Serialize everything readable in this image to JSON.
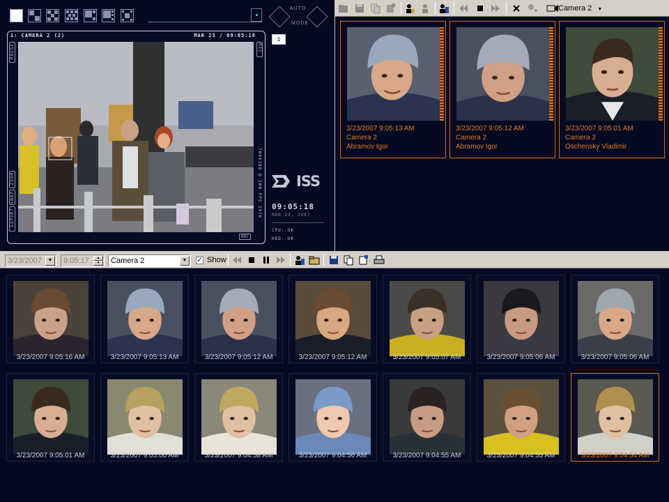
{
  "video": {
    "camera_title": "1: CAMERA 2 (2)",
    "timestamp": "MAR 23 / 09:05:18",
    "resolution_info": "704X288 @ 200 FPS 297K",
    "side_labels": [
      "PAUSE",
      "ZOOM",
      "SNAP",
      "EXPORT"
    ],
    "side_label_right_top": "REC",
    "rec_label": "REC",
    "camera_number": "1",
    "mode_labels": [
      "AUTO",
      "MODE"
    ]
  },
  "branding": {
    "logo": "ISS"
  },
  "clock": {
    "time": "09:05:18",
    "date": "MAR 23, 2007"
  },
  "status": {
    "cpu": "CPU: OK",
    "hdd": "HDD: OK"
  },
  "identification": {
    "camera_select": "Camera 2",
    "matches": [
      {
        "datetime": "3/23/2007 9:05:13 AM",
        "camera": "Camera 2",
        "name": "Abramov Igor"
      },
      {
        "datetime": "3/23/2007 9:05:12 AM",
        "camera": "Camera 2",
        "name": "Abramov Igor"
      },
      {
        "datetime": "3/23/2007 9:05:01 AM",
        "camera": "Camera 2",
        "name": "Oschensky Vladimir"
      }
    ]
  },
  "gallery_toolbar": {
    "date": "3/23/2007",
    "time": "9:05:17",
    "camera": "Camera 2",
    "show_label": "Show",
    "show_checked": "✓"
  },
  "gallery": [
    {
      "time": "3/23/2007 9:05:16 AM"
    },
    {
      "time": "3/23/2007 9:05:13 AM"
    },
    {
      "time": "3/23/2007 9:05:12 AM"
    },
    {
      "time": "3/23/2007 9:05:12 AM"
    },
    {
      "time": "3/23/2007 9:05:07 AM"
    },
    {
      "time": "3/23/2007 9:05:06 AM"
    },
    {
      "time": "3/23/2007 9:05:06 AM"
    },
    {
      "time": "3/23/2007 9:05:01 AM"
    },
    {
      "time": "3/23/2007 9:05:00 AM"
    },
    {
      "time": "3/23/2007 9:04:58 AM"
    },
    {
      "time": "3/23/2007 9:04:56 AM"
    },
    {
      "time": "3/23/2007 9:04:55 AM"
    },
    {
      "time": "3/23/2007 9:04:55 AM"
    },
    {
      "time": "3/23/2007 9:04:54 AM"
    }
  ],
  "colors": {
    "accent": "#e07820",
    "background": "#050a22",
    "toolbar": "#d4d0c8"
  }
}
